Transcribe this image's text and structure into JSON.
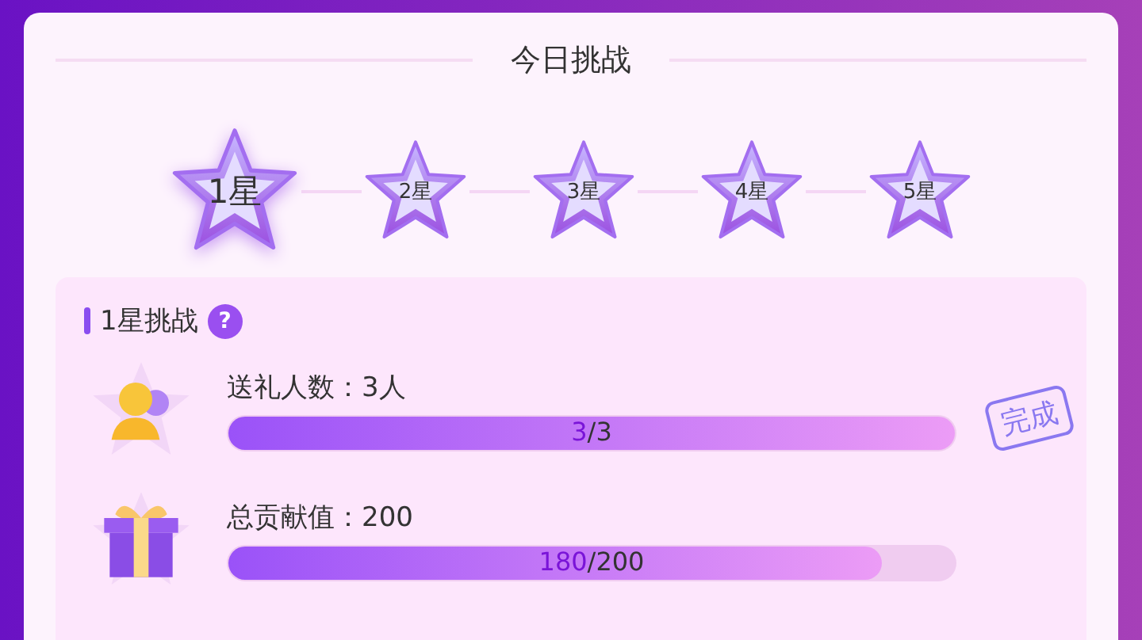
{
  "title": "今日挑战",
  "stars": [
    {
      "label": "1星",
      "selected": true
    },
    {
      "label": "2星",
      "selected": false
    },
    {
      "label": "3星",
      "selected": false
    },
    {
      "label": "4星",
      "selected": false
    },
    {
      "label": "5星",
      "selected": false
    }
  ],
  "challenge": {
    "heading": "1星挑战",
    "help": "?",
    "tasks": [
      {
        "kind": "people",
        "label": "送礼人数：3人",
        "level": 1,
        "current": "3",
        "total": "/3",
        "stamp": "完成"
      },
      {
        "kind": "gift",
        "label": "总贡献值：200",
        "level": 0.9,
        "current": "180",
        "total": "/200"
      }
    ]
  }
}
